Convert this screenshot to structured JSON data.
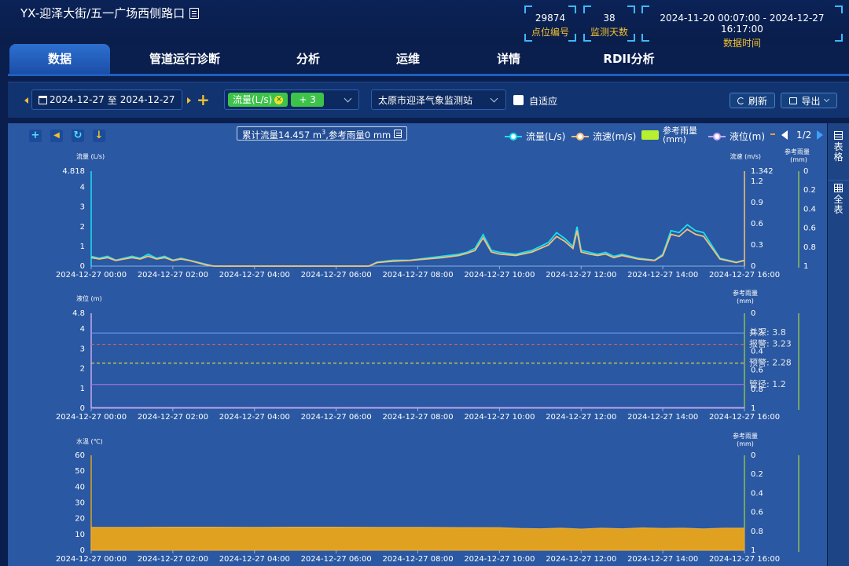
{
  "header": {
    "title": "YX-迎泽大街/五一广场西侧路口",
    "stats": [
      {
        "value": "29874",
        "label": "点位编号"
      },
      {
        "value": "38",
        "label": "监测天数"
      },
      {
        "value": "2024-11-20 00:07:00 - 2024-12-27 16:17:00",
        "label": "数据时间"
      }
    ]
  },
  "tabs": [
    {
      "label": "数据",
      "active": true
    },
    {
      "label": "管道运行诊断",
      "active": false
    },
    {
      "label": "分析",
      "active": false
    },
    {
      "label": "运维",
      "active": false
    },
    {
      "label": "详情",
      "active": false
    },
    {
      "label": "RDII分析",
      "active": false
    }
  ],
  "toolbar": {
    "date_from": "2024-12-27",
    "date_sep": "至",
    "date_to": "2024-12-27",
    "metric_tag": "流量(L/s)",
    "more_tag": "+ 3",
    "station": "太原市迎泽气象监测站",
    "adaptive_label": "自适应",
    "refresh_label": "刷新",
    "export_label": "导出"
  },
  "side": {
    "table_label": "表格",
    "full_label": "全表"
  },
  "tooltip": {
    "text_before": "累计流量14.457 m",
    "sup": "3",
    "text_after": ",参考雨量0 mm"
  },
  "legend": {
    "items": [
      {
        "name": "流量(L/s)",
        "color": "#19e0f0"
      },
      {
        "name": "流速(m/s)",
        "color": "#f5c07a"
      },
      {
        "name": "参考雨量(mm)",
        "color": "#b8f030"
      },
      {
        "name": "液位(m)",
        "color": "#c8a8f0"
      }
    ],
    "page": "1/2"
  },
  "chart_data": [
    {
      "type": "line",
      "title": "",
      "ylabel": "流量 (L/s)",
      "y2label": "流速 (m/s)",
      "y3label": "参考雨量 (mm)",
      "ylim": [
        0,
        4.818
      ],
      "y_ticks": [
        "0",
        "1",
        "2",
        "3",
        "4",
        "4.818"
      ],
      "y2lim": [
        0,
        1.342
      ],
      "y2_ticks": [
        "0",
        "0.3",
        "0.6",
        "0.9",
        "1.2",
        "1.342"
      ],
      "y3_ticks": [
        "0",
        "0.2",
        "0.4",
        "0.6",
        "0.8",
        "1"
      ],
      "x_ticks": [
        "2024-12-27 00:00",
        "2024-12-27 02:00",
        "2024-12-27 04:00",
        "2024-12-27 06:00",
        "2024-12-27 08:00",
        "2024-12-27 10:00",
        "2024-12-27 12:00",
        "2024-12-27 14:00",
        "2024-12-27 16:00"
      ],
      "series": [
        {
          "name": "流量(L/s)",
          "color": "#19e0f0",
          "x": [
            0,
            0.2,
            0.4,
            0.6,
            0.8,
            1.0,
            1.2,
            1.4,
            1.6,
            1.8,
            2.0,
            2.2,
            2.4,
            2.6,
            2.8,
            3.0,
            4.0,
            5.0,
            6.0,
            6.8,
            7.0,
            7.4,
            7.8,
            8.2,
            8.6,
            9.0,
            9.2,
            9.4,
            9.6,
            9.8,
            10.0,
            10.4,
            10.8,
            11.2,
            11.4,
            11.6,
            11.8,
            11.9,
            12.0,
            12.2,
            12.4,
            12.6,
            12.8,
            13.0,
            13.4,
            13.8,
            14.0,
            14.2,
            14.4,
            14.6,
            14.8,
            15.0,
            15.4,
            15.8,
            16.0
          ],
          "values": [
            0.5,
            0.4,
            0.5,
            0.3,
            0.4,
            0.5,
            0.4,
            0.6,
            0.4,
            0.5,
            0.3,
            0.4,
            0.3,
            0.2,
            0.1,
            0,
            0,
            0,
            0,
            0,
            0.2,
            0.3,
            0.3,
            0.4,
            0.5,
            0.6,
            0.7,
            0.9,
            1.6,
            0.8,
            0.7,
            0.6,
            0.8,
            1.2,
            1.7,
            1.4,
            1.0,
            2.0,
            0.8,
            0.7,
            0.6,
            0.7,
            0.5,
            0.6,
            0.4,
            0.3,
            0.6,
            1.8,
            1.7,
            2.1,
            1.8,
            1.7,
            0.4,
            0.2,
            0.3
          ]
        },
        {
          "name": "流速(m/s)",
          "color": "#f5c07a",
          "x": [
            0,
            0.2,
            0.4,
            0.6,
            0.8,
            1.0,
            1.2,
            1.4,
            1.6,
            1.8,
            2.0,
            2.2,
            2.4,
            2.6,
            2.8,
            3.0,
            4.0,
            5.0,
            6.0,
            6.8,
            7.0,
            7.4,
            7.8,
            8.2,
            8.6,
            9.0,
            9.2,
            9.4,
            9.6,
            9.8,
            10.0,
            10.4,
            10.8,
            11.2,
            11.4,
            11.6,
            11.8,
            11.9,
            12.0,
            12.2,
            12.4,
            12.6,
            12.8,
            13.0,
            13.4,
            13.8,
            14.0,
            14.2,
            14.4,
            14.6,
            14.8,
            15.0,
            15.4,
            15.8,
            16.0
          ],
          "values": [
            0.12,
            0.1,
            0.12,
            0.08,
            0.1,
            0.12,
            0.1,
            0.14,
            0.1,
            0.12,
            0.08,
            0.1,
            0.08,
            0.05,
            0.02,
            0,
            0,
            0,
            0,
            0,
            0.05,
            0.07,
            0.08,
            0.1,
            0.12,
            0.15,
            0.18,
            0.22,
            0.4,
            0.2,
            0.17,
            0.15,
            0.2,
            0.3,
            0.42,
            0.35,
            0.25,
            0.5,
            0.2,
            0.17,
            0.15,
            0.17,
            0.12,
            0.15,
            0.1,
            0.08,
            0.15,
            0.45,
            0.42,
            0.52,
            0.45,
            0.42,
            0.1,
            0.05,
            0.08
          ]
        }
      ]
    },
    {
      "type": "line",
      "title": "",
      "ylabel": "液位 (m)",
      "y3label": "参考雨量 (mm)",
      "ylim": [
        0,
        4.8
      ],
      "y_ticks": [
        "0",
        "1",
        "2",
        "3",
        "4",
        "4.8"
      ],
      "y3_ticks": [
        "0",
        "0.2",
        "0.4",
        "0.6",
        "0.8",
        "1"
      ],
      "x_ticks": [
        "2024-12-27 00:00",
        "2024-12-27 02:00",
        "2024-12-27 04:00",
        "2024-12-27 06:00",
        "2024-12-27 08:00",
        "2024-12-27 10:00",
        "2024-12-27 12:00",
        "2024-12-27 14:00",
        "2024-12-27 16:00"
      ],
      "thresholds": [
        {
          "label": "井深: 3.8",
          "value": 3.8,
          "color": "#6a9af0",
          "style": "solid"
        },
        {
          "label": "报警: 3.23",
          "value": 3.23,
          "color": "#e06060",
          "style": "dashed"
        },
        {
          "label": "预警: 2.28",
          "value": 2.28,
          "color": "#e0d040",
          "style": "dashed"
        },
        {
          "label": "管径: 1.2",
          "value": 1.2,
          "color": "#a070e0",
          "style": "solid"
        }
      ],
      "series": [
        {
          "name": "液位(m)",
          "color": "#c8a8f0",
          "x": [
            0,
            16
          ],
          "values": [
            0.02,
            0.02
          ]
        }
      ]
    },
    {
      "type": "area",
      "title": "",
      "ylabel": "水温 (℃)",
      "y3label": "参考雨量 (mm)",
      "ylim": [
        0,
        60
      ],
      "y_ticks": [
        "0",
        "10",
        "20",
        "30",
        "40",
        "50",
        "60"
      ],
      "y3_ticks": [
        "0",
        "0.2",
        "0.4",
        "0.6",
        "0.8",
        "1"
      ],
      "x_ticks": [
        "2024-12-27 00:00",
        "2024-12-27 02:00",
        "2024-12-27 04:00",
        "2024-12-27 06:00",
        "2024-12-27 08:00",
        "2024-12-27 10:00",
        "2024-12-27 12:00",
        "2024-12-27 14:00",
        "2024-12-27 16:00"
      ],
      "series": [
        {
          "name": "水温",
          "color": "#e0a020",
          "x": [
            0,
            1,
            2,
            3,
            4,
            5,
            6,
            7,
            8,
            9,
            10,
            10.5,
            11,
            11.5,
            12,
            12.5,
            13,
            13.5,
            14,
            14.5,
            15,
            15.5,
            16
          ],
          "values": [
            14.5,
            14.5,
            14.6,
            14.6,
            14.5,
            14.6,
            14.6,
            14.5,
            14.5,
            14.4,
            14.3,
            13.8,
            13.6,
            14.0,
            13.4,
            14.0,
            13.6,
            14.2,
            13.8,
            14.0,
            13.5,
            14.0,
            14.0
          ]
        }
      ]
    }
  ]
}
